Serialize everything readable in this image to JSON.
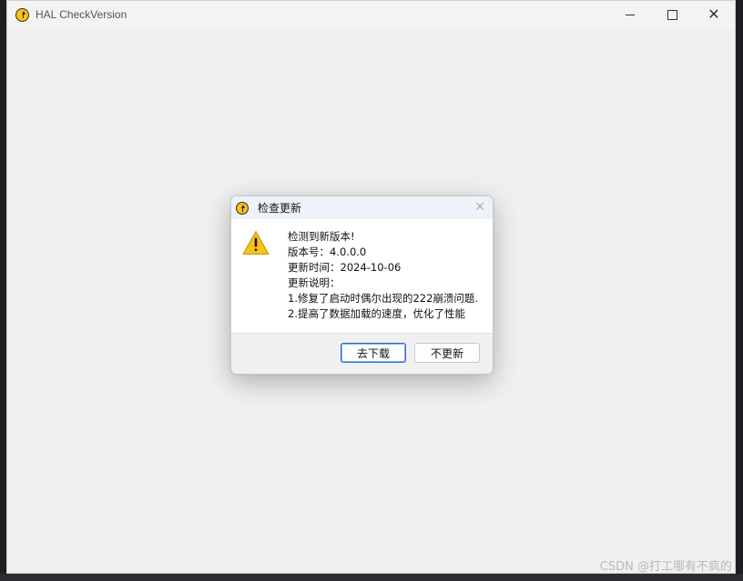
{
  "window": {
    "title": "HAL CheckVersion",
    "controls": {
      "minimize_icon": "minimize-icon",
      "maximize_icon": "maximize-icon",
      "close_icon": "close-icon"
    }
  },
  "dialog": {
    "title": "检查更新",
    "close_glyph": "✕",
    "lines": [
      "检测到新版本!",
      "版本号：4.0.0.0",
      "更新时间：2024-10-06",
      "更新说明：",
      "1.修复了启动时偶尔出现的222崩溃问题.",
      "2.提高了数据加载的速度，优化了性能"
    ],
    "buttons": {
      "download": "去下载",
      "skip": "不更新"
    }
  },
  "watermark": "CSDN @打工哪有不疯的",
  "colors": {
    "accent": "#2d6bc4",
    "warning": "#f7c21a"
  }
}
